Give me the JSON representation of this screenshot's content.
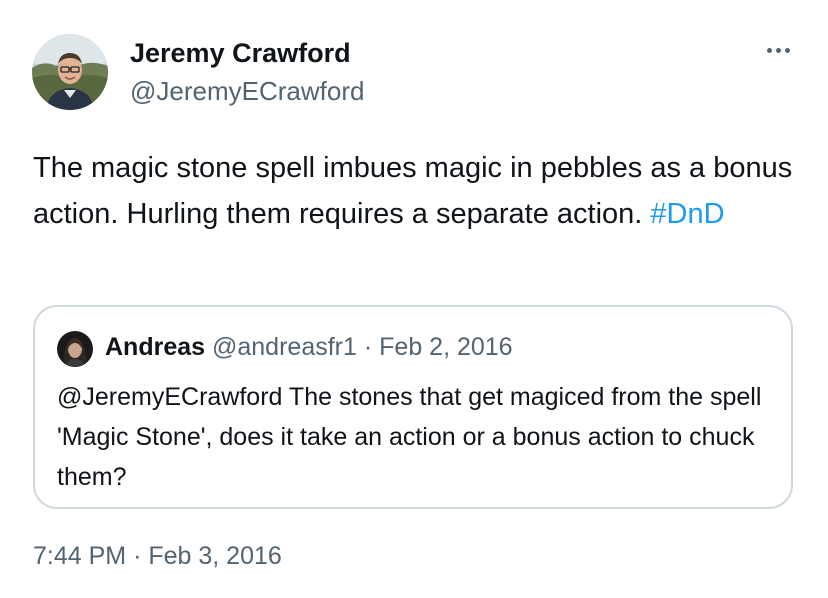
{
  "author": {
    "name": "Jeremy Crawford",
    "handle": "@JeremyECrawford"
  },
  "menu": {
    "icon": "more-horizontal-icon"
  },
  "tweet": {
    "text": "The magic stone spell imbues magic in pebbles as a bonus action. Hurling them requires a separate action.",
    "hashtag": "#DnD"
  },
  "quoted": {
    "name": "Andreas",
    "handle": "@andreasfr1",
    "separator": "·",
    "date": "Feb 2, 2016",
    "text": "@JeremyECrawford The stones that get magiced from the spell 'Magic Stone', does it take an action or a bonus action to chuck them?"
  },
  "timestamp": {
    "time": "7:44 PM",
    "separator": "·",
    "date": "Feb 3, 2016"
  },
  "colors": {
    "text": "#0f1419",
    "secondary": "#536471",
    "link": "#1d9bf0",
    "border": "#cfd9de"
  }
}
